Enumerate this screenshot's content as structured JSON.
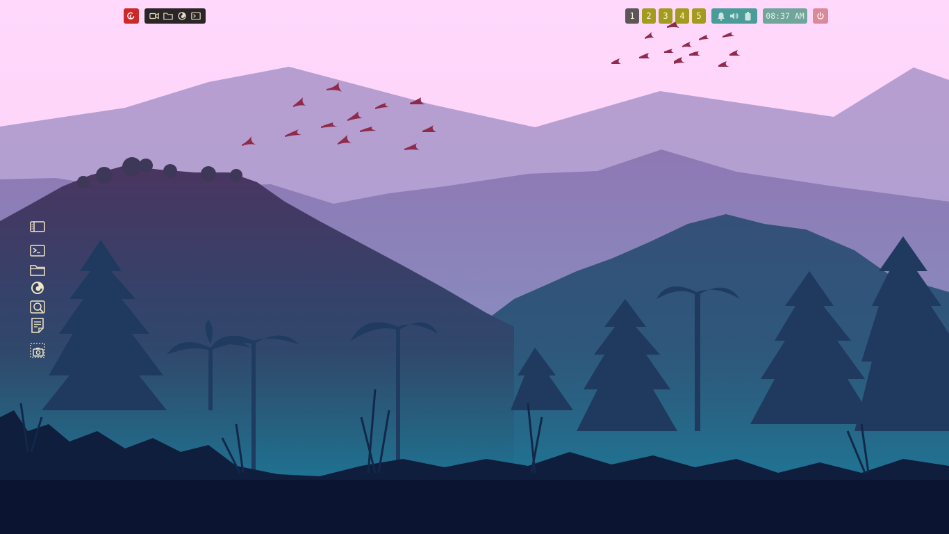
{
  "desktop": {
    "wallpaper": "mountain-forest-landscape",
    "colors": {
      "sky": "#ffd6fb",
      "menu_button": "#cc2a2a",
      "launcher_bg": "#2a2628",
      "workspace_active": "#5c5658",
      "workspace_inactive": "#a39b1e",
      "tray_bg": "#4a9c98",
      "clock_bg": "#6fa59a",
      "power_bg": "#d98a99",
      "dock_icon": "#f1e6c7"
    }
  },
  "topbar": {
    "menu_icon": "debian-swirl-icon",
    "launcher": [
      "video-camera-icon",
      "folder-icon",
      "firefox-icon",
      "terminal-icon"
    ],
    "workspaces": [
      {
        "label": "1",
        "active": true
      },
      {
        "label": "2",
        "active": false
      },
      {
        "label": "3",
        "active": false
      },
      {
        "label": "4",
        "active": false
      },
      {
        "label": "5",
        "active": false
      }
    ],
    "tray": [
      "bell-icon",
      "volume-icon",
      "battery-icon"
    ],
    "clock": "08:37 AM",
    "power_icon": "power-icon"
  },
  "dock": {
    "items": [
      "sidebar-panel-icon",
      "terminal-icon",
      "folder-icon",
      "firefox-icon",
      "search-window-icon",
      "notes-icon",
      "screenshot-icon"
    ]
  }
}
